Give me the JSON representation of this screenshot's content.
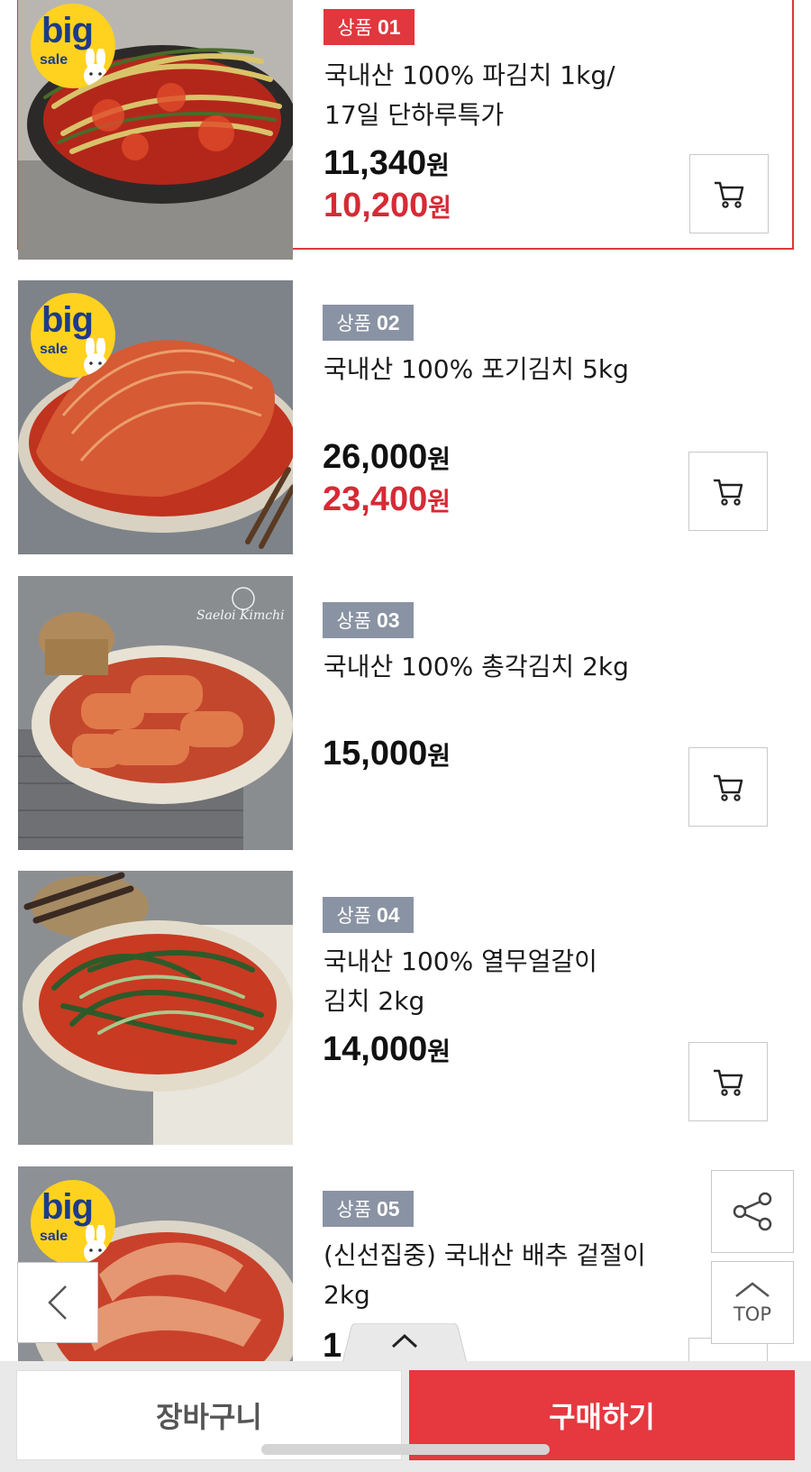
{
  "products": [
    {
      "badge_prefix": "상품",
      "badge_num": "01",
      "name_line1": "국내산 100% 파김치 1kg/",
      "name_line2": "17일 단하루특가",
      "price": "11,340",
      "sale_price": "10,200",
      "currency": "원",
      "big_sale_badge": true
    },
    {
      "badge_prefix": "상품",
      "badge_num": "02",
      "name_line1": "국내산 100% 포기김치 5kg",
      "name_line2": "",
      "price": "26,000",
      "sale_price": "23,400",
      "currency": "원",
      "big_sale_badge": true
    },
    {
      "badge_prefix": "상품",
      "badge_num": "03",
      "name_line1": "국내산 100% 총각김치 2kg",
      "name_line2": "",
      "price": "15,000",
      "sale_price": "",
      "currency": "원",
      "watermark": "Saeloi Kimchi"
    },
    {
      "badge_prefix": "상품",
      "badge_num": "04",
      "name_line1": "국내산 100% 열무얼갈이",
      "name_line2": "김치 2kg",
      "price": "14,000",
      "sale_price": "",
      "currency": "원"
    },
    {
      "badge_prefix": "상품",
      "badge_num": "05",
      "name_line1": "(신선집중) 국내산 배추 겉절이",
      "name_line2": "2kg",
      "price_partial": "1",
      "big_sale_badge": true
    }
  ],
  "big_sale": {
    "word1": "big",
    "word2": "sale"
  },
  "floating": {
    "top_label": "TOP"
  },
  "bottom_bar": {
    "cart_label": "장바구니",
    "buy_label": "구매하기"
  },
  "colors": {
    "accent": "#e5383f",
    "sale_price": "#d52b35",
    "badge_gray": "#8a93a3"
  },
  "icons": [
    "cart-icon",
    "share-icon",
    "back-arrow-icon",
    "top-arrow-icon",
    "chevron-up-icon"
  ]
}
